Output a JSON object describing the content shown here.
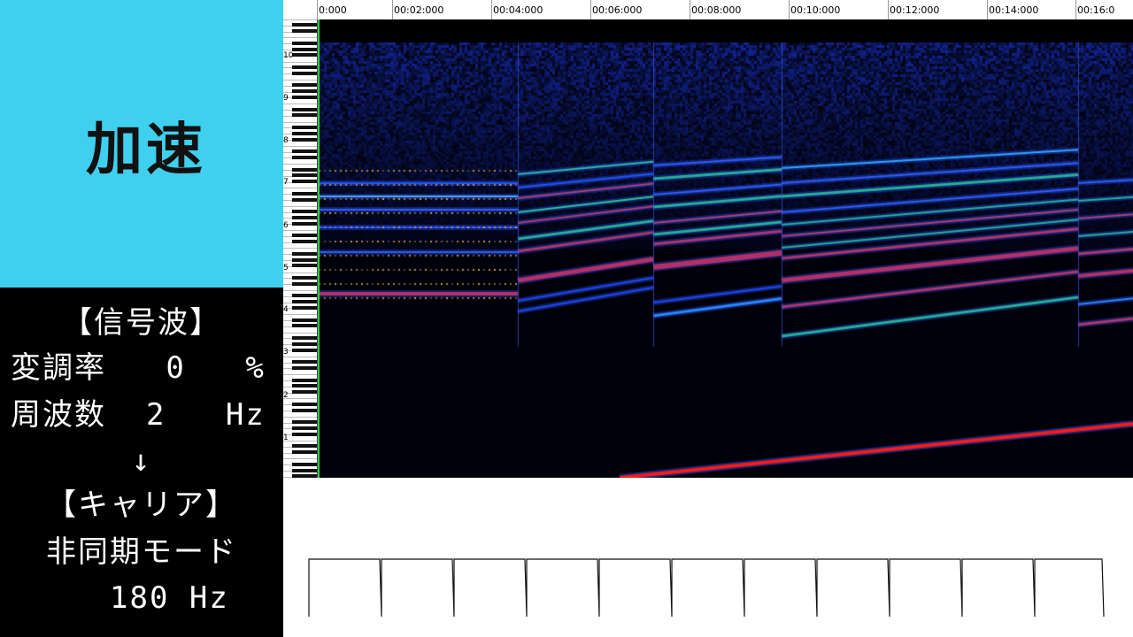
{
  "title": {
    "text": "加速"
  },
  "info": {
    "signal_header": "【信号波】",
    "modulation_label": "変調率",
    "modulation_value": "0",
    "modulation_unit": "%",
    "frequency_label": "周波数",
    "frequency_value": "2",
    "frequency_unit": "Hz",
    "arrow": "↓",
    "carrier_header": "【キャリア】",
    "carrier_mode": "非同期モード",
    "carrier_frequency": "180 Hz"
  },
  "timeline": {
    "labels": [
      "0:000",
      "00:02:000",
      "00:04:000",
      "00:06:000",
      "00:08:000",
      "00:10:000",
      "00:12:000",
      "00:14:000",
      "00:16:0"
    ]
  },
  "keyboard": {
    "octave_labels": [
      "10",
      "9",
      "8",
      "7",
      "6",
      "5",
      "4",
      "3",
      "2",
      "1"
    ]
  },
  "colors": {
    "title_bg": "#3ed0ee",
    "spectrum_bg": "#000000",
    "playhead": "#2ecc40",
    "strong_band": "#ff1a1a",
    "mid_band": "#22e060",
    "weak_band": "#1a3cff"
  }
}
